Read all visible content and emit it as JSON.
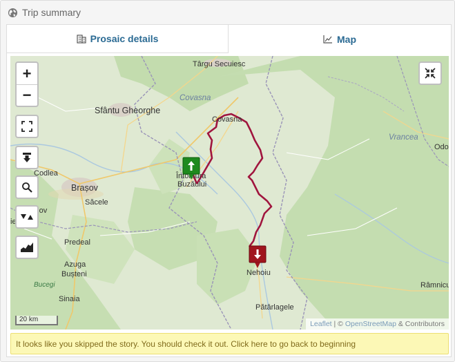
{
  "header": {
    "title": "Trip summary",
    "icon": "globe-icon"
  },
  "tabs": [
    {
      "label": "Prosaic details",
      "icon": "building-icon",
      "active": false
    },
    {
      "label": "Map",
      "icon": "chart-line-icon",
      "active": true
    }
  ],
  "map": {
    "controls": {
      "zoom_in": "+",
      "zoom_out": "−",
      "fullscreen_icon": "fullscreen-icon",
      "exit_fullscreen_icon": "collapse-icon",
      "download_icon": "download-icon",
      "search_icon": "search-icon",
      "toggle_icon": "triangles-icon",
      "elevation_icon": "elevation-icon"
    },
    "labels": {
      "targu_secuiesc": "Târgu Secuiesc",
      "covasna_region": "Covasna",
      "sfantu_gheorghe": "Sfântu Gheorghe",
      "covasna_town": "Covasna",
      "vrancea": "Vrancea",
      "odo": "Odo",
      "codlea": "Codlea",
      "intorsura_1": "Întorsura",
      "intorsura_2": "Buzăului",
      "brasov": "Brașov",
      "sacele": "Săcele",
      "rasnov": "Râșnov",
      "es": "ieș",
      "predeal": "Predeal",
      "azuga": "Azuga",
      "busteni": "Bușteni",
      "bucegi": "Bucegi",
      "sinaia": "Sinaia",
      "nehoiu": "Nehoiu",
      "ramnicu": "Râmnicu",
      "patarlagele": "Pătârlagele"
    },
    "scale": "20 km",
    "attribution": {
      "leaflet": "Leaflet",
      "sep": " | © ",
      "osm": "OpenStreetMap",
      "rest": " & Contributors"
    },
    "colors": {
      "track": "#a0153e",
      "start_marker": "#1e8a1e",
      "end_marker": "#a0151e",
      "borders": "#8a8aa8"
    }
  },
  "notice": "It looks like you skipped the story. You should check it out. Click here to go back to beginning"
}
